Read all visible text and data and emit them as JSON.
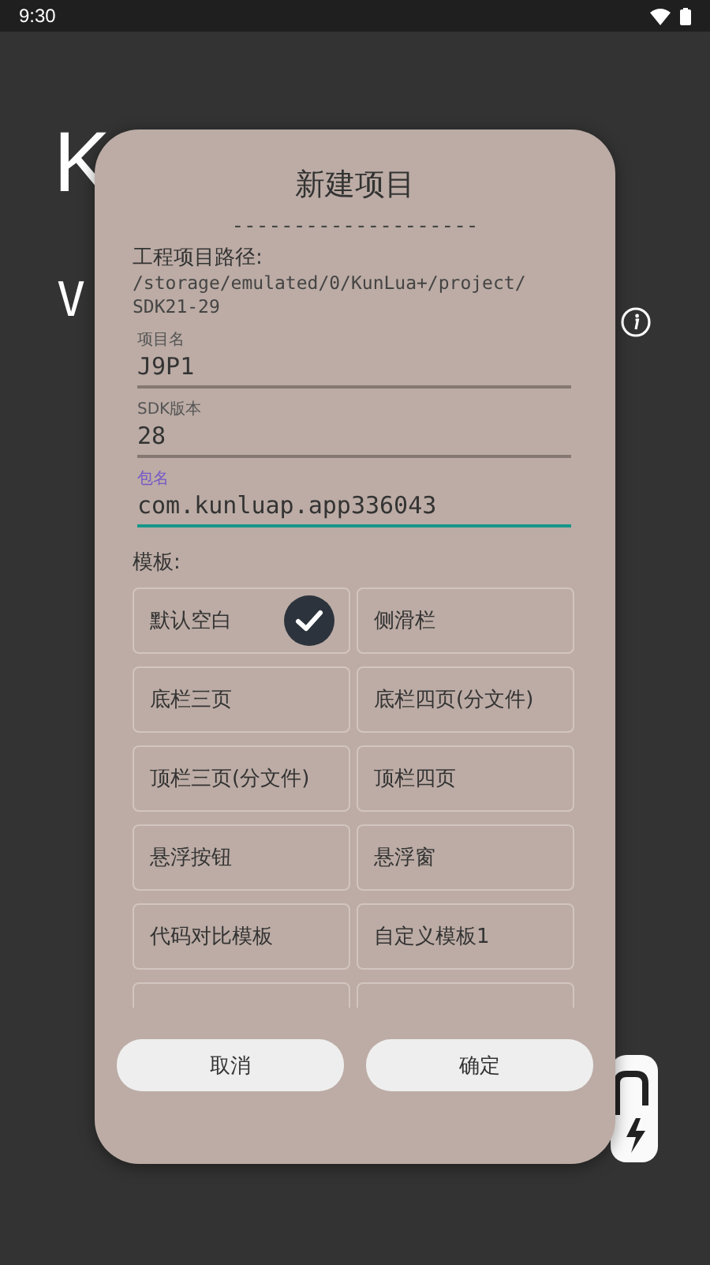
{
  "status_bar": {
    "time": "9:30"
  },
  "background": {
    "title": "K",
    "version": "V"
  },
  "dialog": {
    "title": "新建项目",
    "divider": "--------------------",
    "path_label": "工程项目路径:",
    "path": "/storage/emulated/0/KunLua+/project/\nSDK21-29",
    "fields": [
      {
        "label": "项目名",
        "value": "J9P1",
        "focused": false
      },
      {
        "label": "SDK版本",
        "value": "28",
        "focused": false
      },
      {
        "label": "包名",
        "value": "com.kunluap.app336043",
        "focused": true
      }
    ],
    "templates_label": "模板:",
    "templates": [
      {
        "label": "默认空白",
        "selected": true
      },
      {
        "label": "侧滑栏",
        "selected": false
      },
      {
        "label": "底栏三页",
        "selected": false
      },
      {
        "label": "底栏四页(分文件)",
        "selected": false
      },
      {
        "label": "顶栏三页(分文件)",
        "selected": false
      },
      {
        "label": "顶栏四页",
        "selected": false
      },
      {
        "label": "悬浮按钮",
        "selected": false
      },
      {
        "label": "悬浮窗",
        "selected": false
      },
      {
        "label": "代码对比模板",
        "selected": false
      },
      {
        "label": "自定义模板1",
        "selected": false
      },
      {
        "selected": false
      },
      {
        "selected": false
      }
    ],
    "buttons": [
      "取消",
      "确定"
    ]
  }
}
